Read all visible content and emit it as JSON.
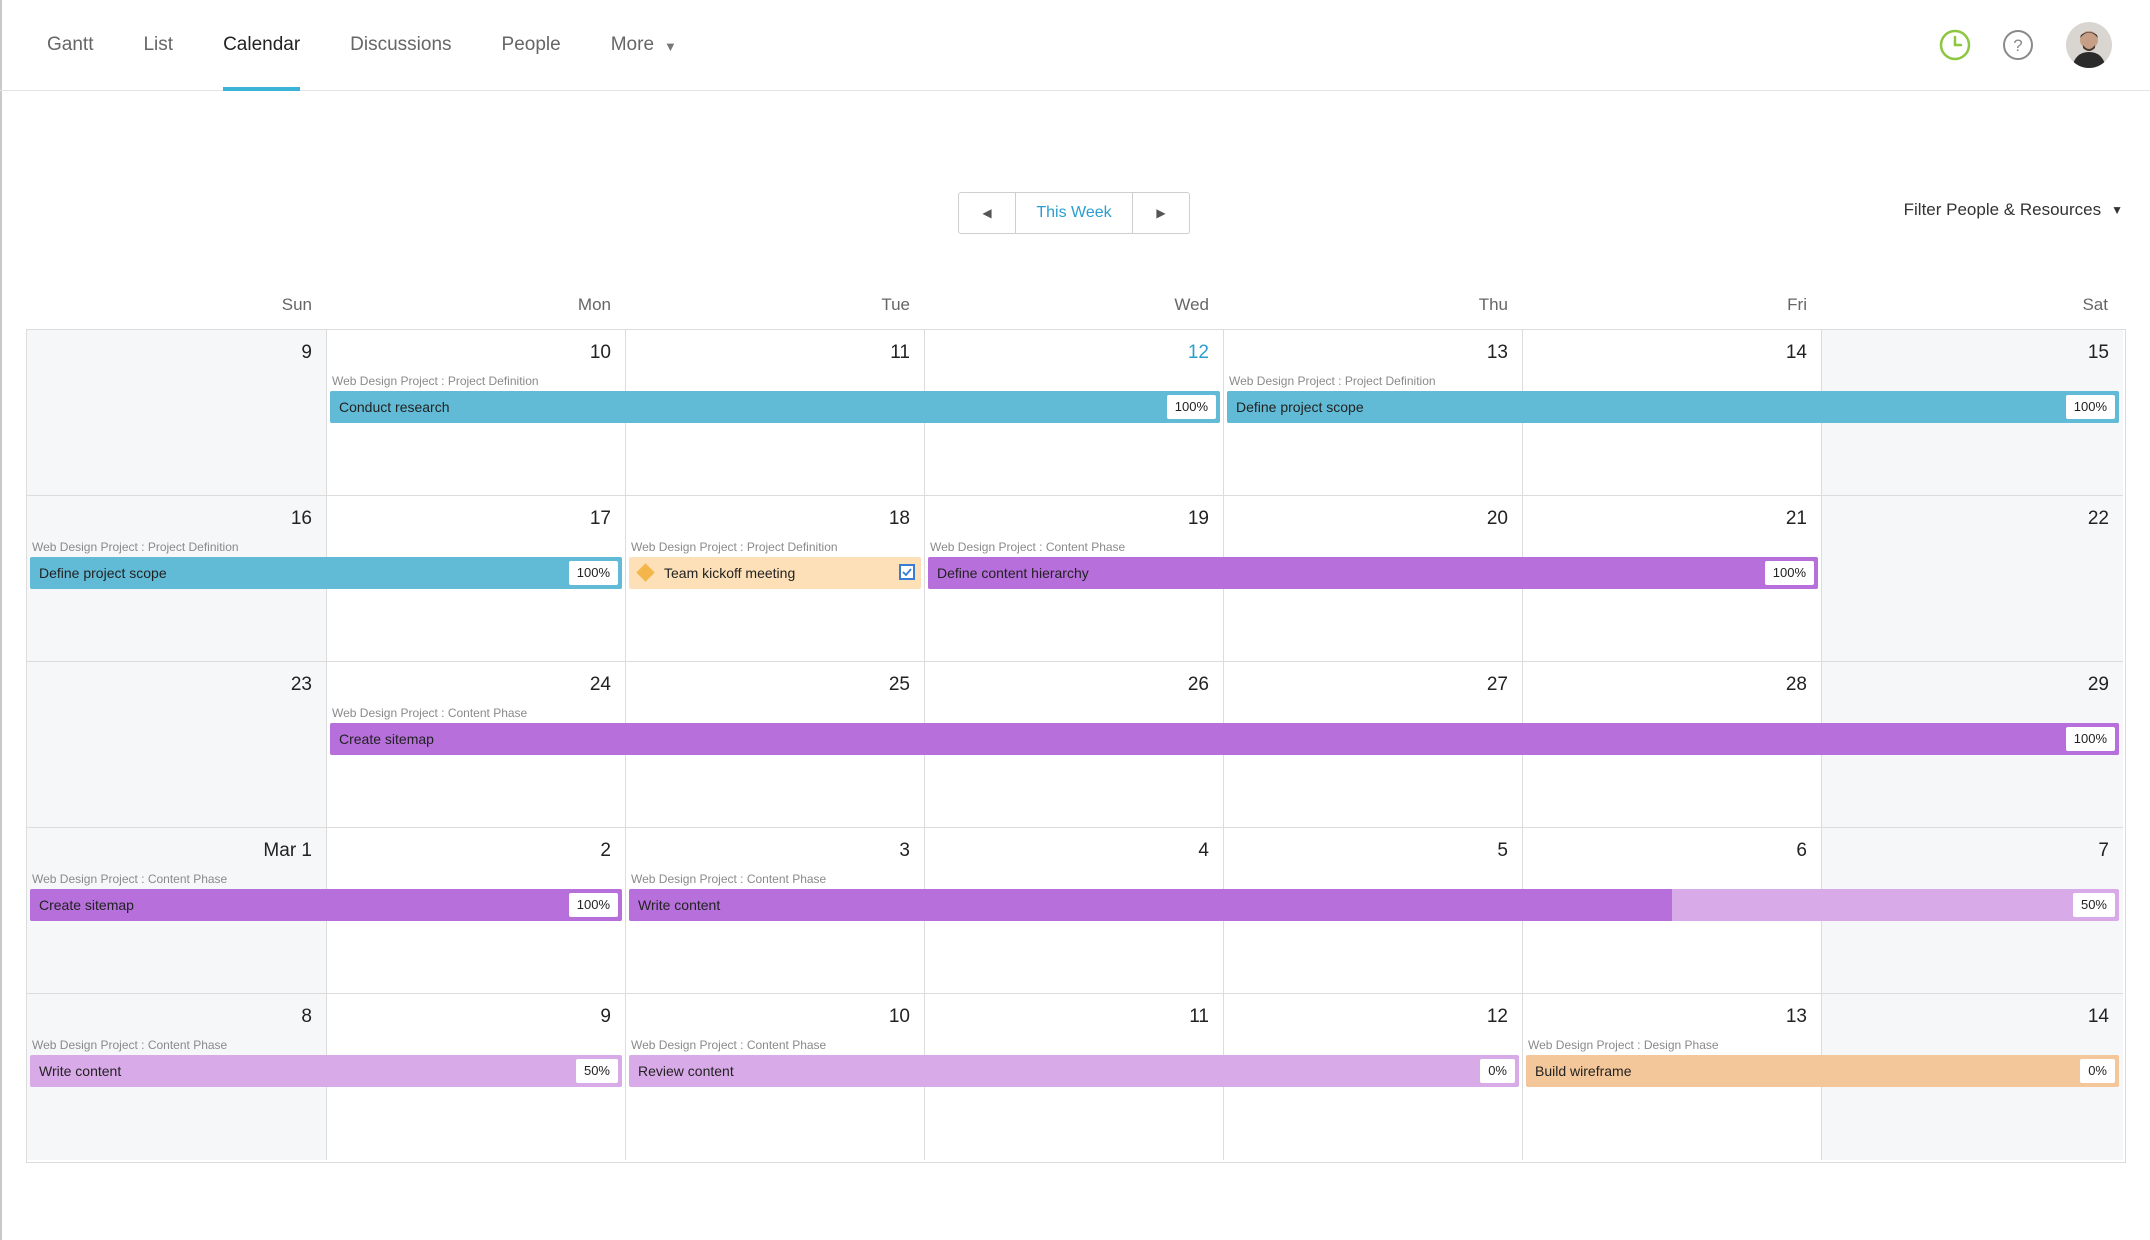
{
  "nav": {
    "tabs": [
      {
        "label": "Gantt",
        "active": false
      },
      {
        "label": "List",
        "active": false
      },
      {
        "label": "Calendar",
        "active": true
      },
      {
        "label": "Discussions",
        "active": false
      },
      {
        "label": "People",
        "active": false
      },
      {
        "label": "More",
        "active": false,
        "has_dropdown": true
      }
    ],
    "icons": [
      "clock-icon",
      "help-icon",
      "user-avatar"
    ]
  },
  "controls": {
    "prev_icon": "prev-arrow-icon",
    "this_week_label": "This Week",
    "next_icon": "next-arrow-icon",
    "filter_label": "Filter People & Resources"
  },
  "calendar": {
    "day_names": [
      "Sun",
      "Mon",
      "Tue",
      "Wed",
      "Thu",
      "Fri",
      "Sat"
    ],
    "today": "12",
    "weeks": [
      [
        "9",
        "10",
        "11",
        "12",
        "13",
        "14",
        "15"
      ],
      [
        "16",
        "17",
        "18",
        "19",
        "20",
        "21",
        "22"
      ],
      [
        "23",
        "24",
        "25",
        "26",
        "27",
        "28",
        "29"
      ],
      [
        "Mar 1",
        "2",
        "3",
        "4",
        "5",
        "6",
        "7"
      ],
      [
        "8",
        "9",
        "10",
        "11",
        "12",
        "13",
        "14"
      ]
    ],
    "tasks": [
      {
        "week": 0,
        "start": 1,
        "end": 3,
        "project": "Web Design Project : Project Definition",
        "name": "Conduct research",
        "percent_label": "100%",
        "progress": 1.0,
        "color": "#62bbd6",
        "light_color": "#bfe3ee",
        "type": "task"
      },
      {
        "week": 0,
        "start": 4,
        "end": 6,
        "project": "Web Design Project : Project Definition",
        "name": "Define project scope",
        "percent_label": "100%",
        "progress": 1.0,
        "color": "#62bbd6",
        "light_color": "#bfe3ee",
        "type": "task"
      },
      {
        "week": 1,
        "start": 0,
        "end": 1,
        "project": "Web Design Project : Project Definition",
        "name": "Define project scope",
        "percent_label": "100%",
        "progress": 1.0,
        "color": "#62bbd6",
        "light_color": "#bfe3ee",
        "type": "task"
      },
      {
        "week": 1,
        "start": 2,
        "end": 2,
        "project": "Web Design Project : Project Definition",
        "name": "Team kickoff meeting",
        "percent_label": "",
        "progress": 1.0,
        "color": "#fde0b8",
        "light_color": "#fde0b8",
        "type": "milestone"
      },
      {
        "week": 1,
        "start": 3,
        "end": 5,
        "project": "Web Design Project : Content Phase",
        "name": "Define content hierarchy",
        "percent_label": "100%",
        "progress": 1.0,
        "color": "#b76fdb",
        "light_color": "#d9aae8",
        "type": "task"
      },
      {
        "week": 2,
        "start": 1,
        "end": 6,
        "project": "Web Design Project : Content Phase",
        "name": "Create sitemap",
        "percent_label": "100%",
        "progress": 1.0,
        "color": "#b76fdb",
        "light_color": "#d9aae8",
        "type": "task"
      },
      {
        "week": 3,
        "start": 0,
        "end": 1,
        "project": "Web Design Project : Content Phase",
        "name": "Create sitemap",
        "percent_label": "100%",
        "progress": 1.0,
        "color": "#b76fdb",
        "light_color": "#d9aae8",
        "type": "task"
      },
      {
        "week": 3,
        "start": 2,
        "end": 6,
        "project": "Web Design Project : Content Phase",
        "name": "Write content",
        "percent_label": "50%",
        "progress": 0.7,
        "color": "#b76fdb",
        "light_color": "#d9aae8",
        "type": "task"
      },
      {
        "week": 4,
        "start": 0,
        "end": 1,
        "project": "Web Design Project : Content Phase",
        "name": "Write content",
        "percent_label": "50%",
        "progress": 0.0,
        "color": "#b76fdb",
        "light_color": "#d9aae8",
        "type": "task"
      },
      {
        "week": 4,
        "start": 2,
        "end": 4,
        "project": "Web Design Project : Content Phase",
        "name": "Review content",
        "percent_label": "0%",
        "progress": 0.0,
        "color": "#b76fdb",
        "light_color": "#d9aae8",
        "type": "task"
      },
      {
        "week": 4,
        "start": 5,
        "end": 6,
        "project": "Web Design Project : Design Phase",
        "name": "Build wireframe",
        "percent_label": "0%",
        "progress": 0.0,
        "color": "#f4c79a",
        "light_color": "#f4c79a",
        "type": "task"
      }
    ]
  }
}
